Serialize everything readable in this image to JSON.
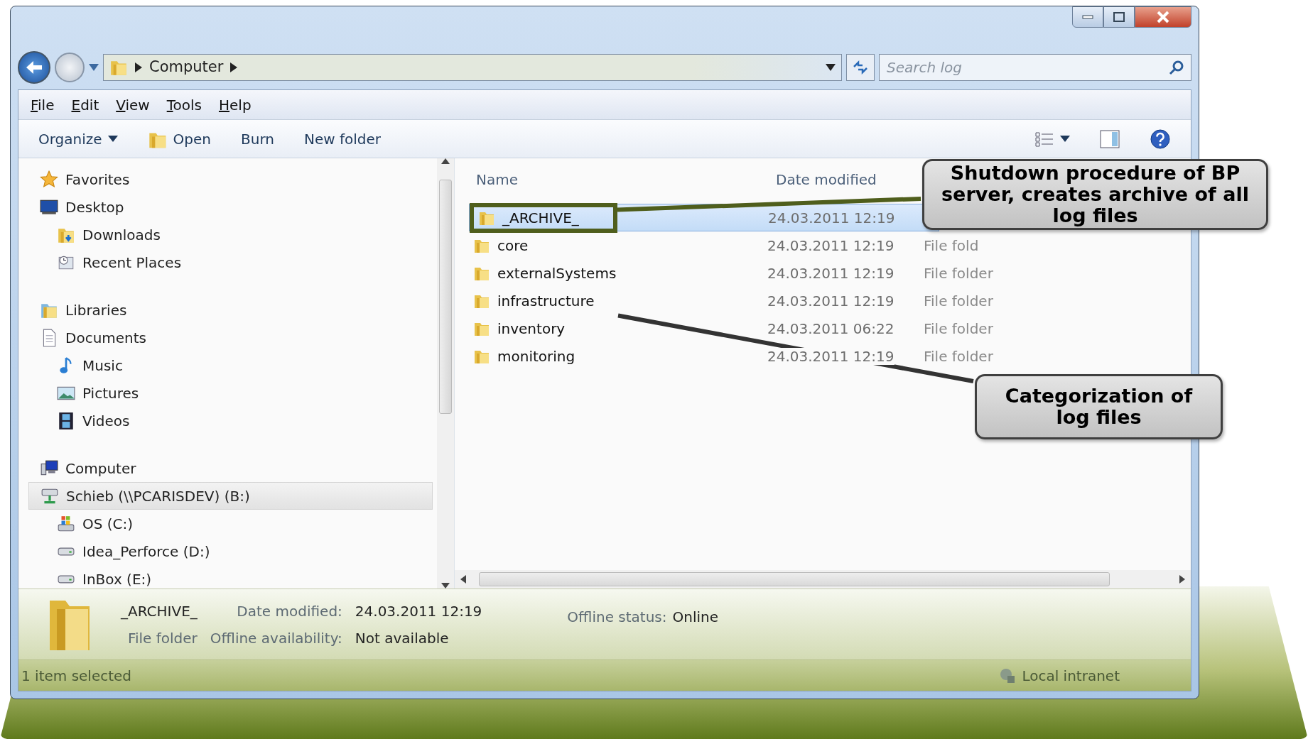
{
  "window": {
    "address": [
      "Computer"
    ],
    "search": {
      "placeholder": "Search log"
    }
  },
  "menu": [
    "File",
    "Edit",
    "View",
    "Tools",
    "Help"
  ],
  "toolbar": [
    {
      "label": "Organize",
      "kind": "dropdown"
    },
    {
      "label": "Open",
      "kind": "icon"
    },
    {
      "label": "Burn",
      "kind": "plain"
    },
    {
      "label": "New folder",
      "kind": "plain"
    }
  ],
  "nav": [
    {
      "label": "Favorites",
      "kind": "star",
      "selected": false,
      "children": [
        {
          "label": "Desktop",
          "kind": "desktop",
          "selected": false
        },
        {
          "label": "Downloads",
          "kind": "downloads",
          "selected": false
        },
        {
          "label": "Recent Places",
          "kind": "recent",
          "selected": false
        }
      ]
    },
    {
      "label": "Libraries",
      "kind": "library",
      "selected": false,
      "children": [
        {
          "label": "Documents",
          "kind": "document",
          "selected": false
        },
        {
          "label": "Music",
          "kind": "music",
          "selected": false
        },
        {
          "label": "Pictures",
          "kind": "pictures",
          "selected": false
        },
        {
          "label": "Videos",
          "kind": "videos",
          "selected": false
        }
      ]
    },
    {
      "label": "Computer",
      "kind": "computer",
      "selected": false,
      "children": [
        {
          "label": "Schieb (\\\\PCARISDEV) (B:)",
          "kind": "network-drive",
          "selected": true
        },
        {
          "label": "OS (C:)",
          "kind": "os-drive",
          "selected": false
        },
        {
          "label": "Idea_Perforce (D:)",
          "kind": "drive",
          "selected": false
        },
        {
          "label": "InBox (E:)",
          "kind": "drive",
          "selected": false
        }
      ]
    }
  ],
  "columns": [
    "Name",
    "Date modified"
  ],
  "files": [
    {
      "name": "_ARCHIVE_",
      "date": "24.03.2011 12:19",
      "selected": true
    },
    {
      "name": "core",
      "date": "24.03.2011 12:19",
      "type": "File fold",
      "selected": false
    },
    {
      "name": "externalSystems",
      "date": "24.03.2011 12:19",
      "type": "File folder",
      "selected": false
    },
    {
      "name": "infrastructure",
      "date": "24.03.2011 12:19",
      "type": "File folder",
      "selected": false
    },
    {
      "name": "inventory",
      "date": "24.03.2011 06:22",
      "type": "File folder",
      "selected": false
    },
    {
      "name": "monitoring",
      "date": "24.03.2011 12:19",
      "type": "File folder",
      "selected": false
    }
  ],
  "details": {
    "name": "_ARCHIVE_",
    "type": "File folder",
    "fields": [
      {
        "label": "Date modified:",
        "value": "24.03.2011 12:19"
      },
      {
        "label": "Offline availability:",
        "value": "Not available"
      },
      {
        "label": "Offline status:",
        "value": "Online"
      }
    ]
  },
  "status_bar": {
    "text": "1 item selected",
    "zone": "Local intranet"
  },
  "callouts": [
    {
      "text": "Shutdown procedure of BP server, creates archive of all log files"
    },
    {
      "text": "Categorization of log files"
    }
  ]
}
